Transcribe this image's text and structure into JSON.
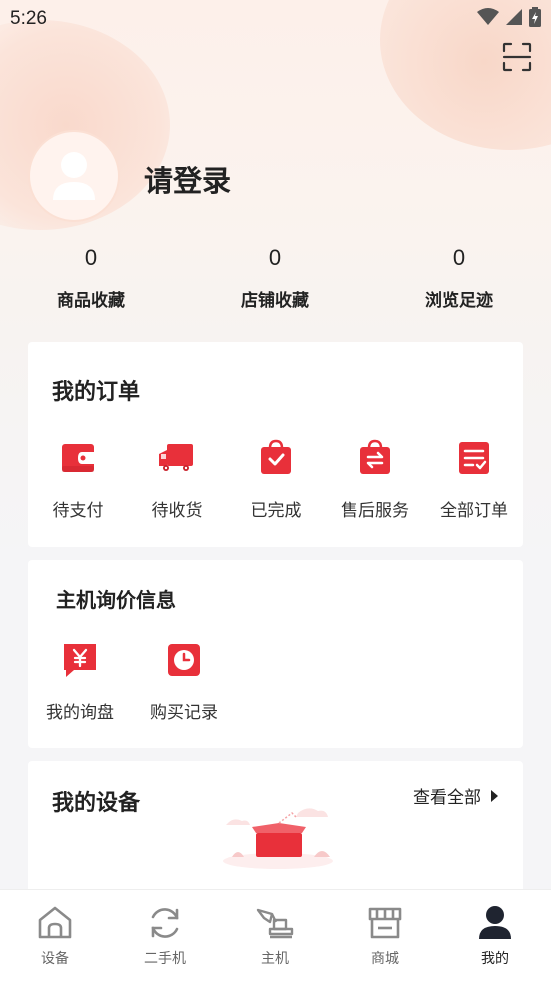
{
  "status_bar": {
    "time": "5:26"
  },
  "profile": {
    "login_text": "请登录"
  },
  "stats": [
    {
      "value": "0",
      "label": "商品收藏"
    },
    {
      "value": "0",
      "label": "店铺收藏"
    },
    {
      "value": "0",
      "label": "浏览足迹"
    }
  ],
  "orders": {
    "title": "我的订单",
    "items": [
      {
        "label": "待支付",
        "icon": "wallet-icon"
      },
      {
        "label": "待收货",
        "icon": "truck-icon"
      },
      {
        "label": "已完成",
        "icon": "bag-check-icon"
      },
      {
        "label": "售后服务",
        "icon": "exchange-icon"
      },
      {
        "label": "全部订单",
        "icon": "order-list-icon"
      }
    ]
  },
  "inquiry": {
    "title": "主机询价信息",
    "items": [
      {
        "label": "我的询盘",
        "icon": "yen-icon"
      },
      {
        "label": "购买记录",
        "icon": "clock-icon"
      }
    ]
  },
  "devices": {
    "title": "我的设备",
    "view_all": "查看全部"
  },
  "tabbar": {
    "items": [
      {
        "label": "设备",
        "icon": "home-icon"
      },
      {
        "label": "二手机",
        "icon": "refresh-icon"
      },
      {
        "label": "主机",
        "icon": "excavator-icon"
      },
      {
        "label": "商城",
        "icon": "store-icon"
      },
      {
        "label": "我的",
        "icon": "person-icon",
        "active": true
      }
    ]
  },
  "colors": {
    "accent": "#e8303a",
    "text": "#222222",
    "bg": "#f5f5f7"
  }
}
